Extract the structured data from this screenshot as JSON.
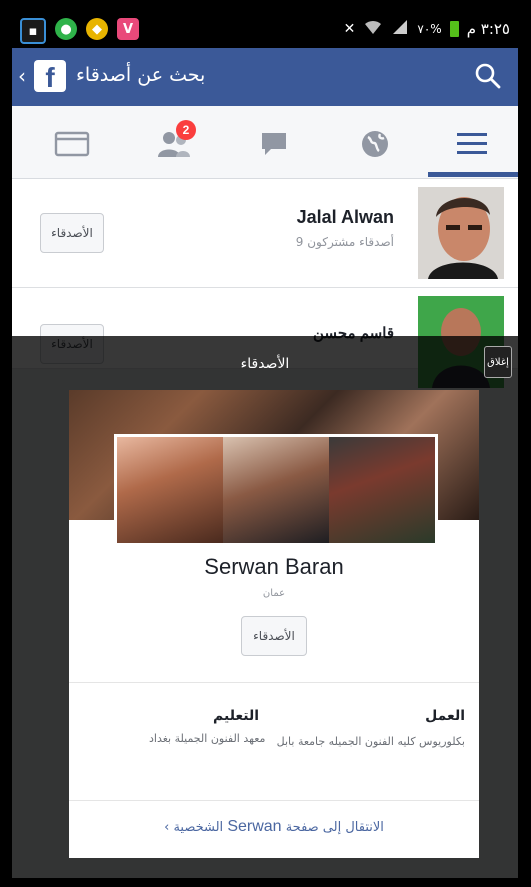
{
  "status_bar": {
    "left_icons": [
      "app-icon-bbm",
      "app-icon-green",
      "app-icon-yellow",
      "app-icon-viber"
    ],
    "time": "٣:٢٥ م",
    "battery_percent": "٧٠%"
  },
  "header": {
    "title": "بحث عن أصدقاء",
    "logo_letter": "f"
  },
  "tabs": {
    "friend_requests_badge": "2"
  },
  "friends_list": [
    {
      "name": "Jalal Alwan",
      "mutual": "9 أصدقاء مشتركون",
      "button": "الأصدقاء"
    },
    {
      "name": "قاسم محسن",
      "mutual": "",
      "button": "الأصدقاء"
    }
  ],
  "overlay": {
    "title": "الأصدقاء",
    "close_label": "إغلاق",
    "profile": {
      "name": "Serwan Baran",
      "location": "عمان",
      "friends_button": "الأصدقاء",
      "work_heading": "العمل",
      "work_value": "بكلوريوس كليه الفنون الجميله جامعة بابل",
      "education_heading": "التعليم",
      "education_value": "معهد الفنون الجميلة بغداد",
      "goto_prefix": "الانتقال إلى صفحة",
      "goto_name": "Serwan",
      "goto_suffix": "الشخصية"
    }
  },
  "colors": {
    "facebook_blue": "#3b5998",
    "badge_red": "#fa3e3e",
    "background_gray": "#e9ebee"
  }
}
